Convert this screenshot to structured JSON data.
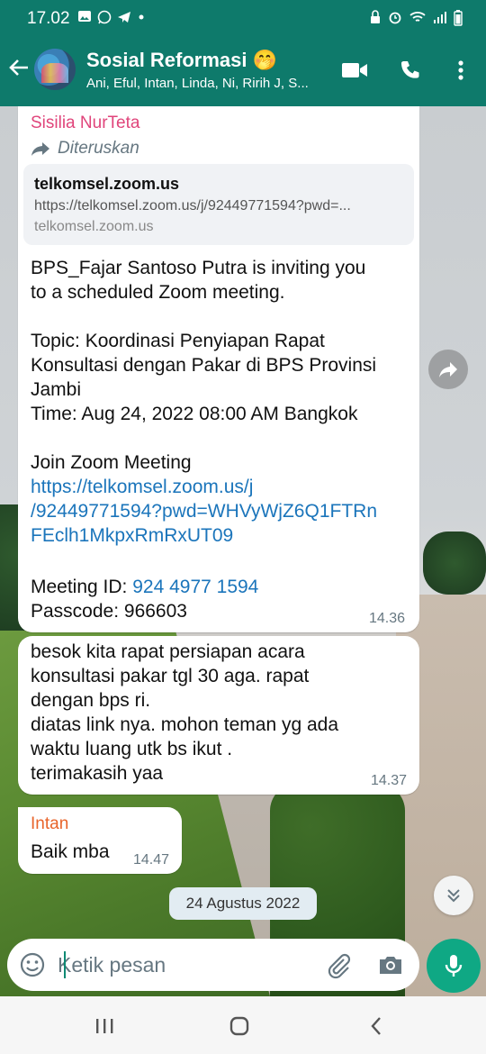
{
  "status_bar": {
    "time": "17.02",
    "left_icons": [
      "gallery-icon",
      "whatsapp-icon",
      "telegram-icon",
      "dot-icon"
    ],
    "right_icons": [
      "lock-icon",
      "alarm-icon",
      "wifi-icon",
      "signal-icon",
      "battery-icon"
    ]
  },
  "header": {
    "title": "Sosial Reformasi 🤭",
    "subtitle": "Ani, Eful, Intan, Linda, Ni, Ririh J, S..."
  },
  "messages": {
    "m1": {
      "sender": "Sisilia NurTeta",
      "forwarded": "Diteruskan",
      "link_preview": {
        "title": "telkomsel.zoom.us",
        "url": "https://telkomsel.zoom.us/j/92449771594?pwd=...",
        "domain": "telkomsel.zoom.us"
      },
      "lines": [
        "BPS_Fajar Santoso Putra is inviting you",
        "to a scheduled Zoom meeting.",
        "Topic: Koordinasi Penyiapan Rapat",
        "Konsultasi dengan Pakar di BPS Provinsi",
        "Jambi",
        "Time: Aug 24, 2022 08:00 AM Bangkok",
        "Join Zoom Meeting"
      ],
      "link_lines": [
        "https://telkomsel.zoom.us/j",
        "/92449771594?pwd=WHVyWjZ6Q1FTRn",
        "FEclh1MkpxRmRxUT09"
      ],
      "meeting_id_label": "Meeting ID: ",
      "meeting_id": "924 4977 1594",
      "passcode": "Passcode: 966603",
      "time": "14.36"
    },
    "m2": {
      "lines": [
        "besok kita rapat persiapan acara",
        "konsultasi pakar tgl 30 aga. rapat",
        "dengan bps ri.",
        "diatas link nya. mohon teman yg ada",
        "waktu luang utk bs ikut .",
        "terimakasih yaa"
      ],
      "time": "14.37"
    },
    "m3": {
      "sender": "Intan",
      "text": "Baik mba",
      "time": "14.47"
    }
  },
  "date_separator": "24 Agustus 2022",
  "composer": {
    "placeholder": "Ketik pesan"
  },
  "colors": {
    "header": "#0e7a6b",
    "accent": "#0fa884",
    "link": "#1b75bb",
    "sender_pink": "#e0457b",
    "sender_orange": "#e8642a"
  }
}
